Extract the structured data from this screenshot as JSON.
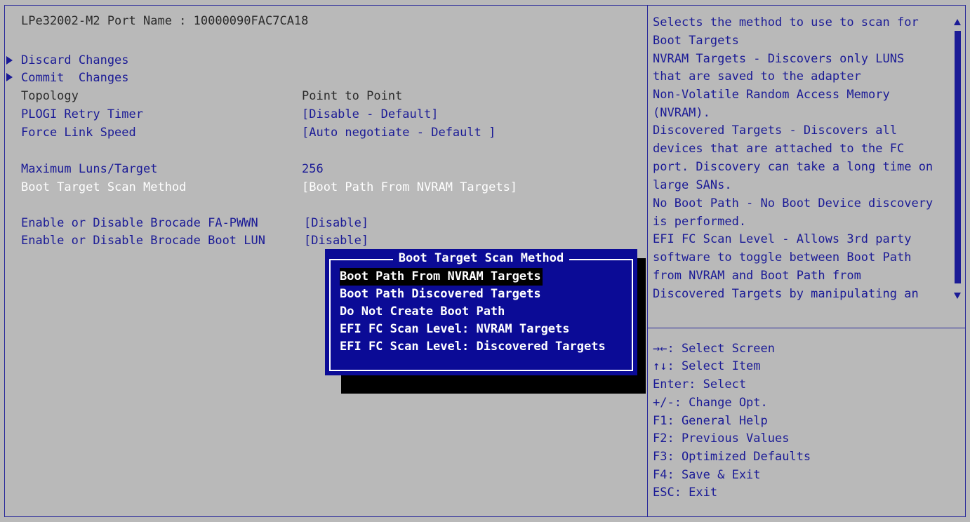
{
  "header": {
    "port_name": "LPe32002-M2 Port Name : 10000090FAC7CA18"
  },
  "menu": {
    "discard": "Discard Changes",
    "commit": "Commit  Changes"
  },
  "settings": [
    {
      "label": "Topology",
      "value": "Point to Point",
      "style": "dark"
    },
    {
      "label": "PLOGI Retry Timer",
      "value": "[Disable - Default]",
      "style": "blue"
    },
    {
      "label": "Force Link Speed",
      "value": "[Auto negotiate - Default ]",
      "style": "blue"
    },
    {
      "label": "Maximum Luns/Target",
      "value": "256",
      "style": "blue"
    },
    {
      "label": "Boot Target Scan Method",
      "value": "[Boot Path From NVRAM Targets]",
      "style": "white"
    },
    {
      "label": "Enable or Disable Brocade FA-PWWN",
      "value": "[Disable]",
      "style": "blue"
    },
    {
      "label": "Enable or Disable Brocade Boot LUN",
      "value": "[Disable]",
      "style": "blue"
    }
  ],
  "popup": {
    "title": "Boot Target Scan Method",
    "options": [
      "Boot Path From NVRAM Targets",
      "Boot Path Discovered Targets",
      "Do Not Create Boot Path",
      "EFI FC Scan Level: NVRAM Targets",
      "EFI FC Scan Level: Discovered Targets"
    ],
    "selected_index": 0
  },
  "help": {
    "lines": [
      "Selects the method to use to scan for",
      "Boot Targets",
      "NVRAM Targets - Discovers only LUNS",
      "that are saved to the adapter",
      "Non-Volatile Random Access Memory",
      "(NVRAM).",
      "Discovered Targets - Discovers all",
      "devices that are attached to the FC",
      "port. Discovery can take a long time on",
      "large SANs.",
      "No Boot Path - No Boot Device discovery",
      "is performed.",
      "EFI FC Scan Level - Allows 3rd party",
      "software to toggle between Boot Path",
      "from NVRAM and Boot Path from",
      "Discovered Targets by manipulating an"
    ]
  },
  "keys": {
    "lines": [
      "→←: Select Screen",
      "↑↓: Select Item",
      "Enter: Select",
      "+/-: Change Opt.",
      "F1: General Help",
      "F2: Previous Values",
      "F3: Optimized Defaults",
      "F4: Save & Exit",
      "ESC: Exit"
    ]
  },
  "colors": {
    "background": "#b9b9b9",
    "text_blue": "#1b1b96",
    "popup_bg": "#0b0b96",
    "highlight": "#ffffff"
  }
}
